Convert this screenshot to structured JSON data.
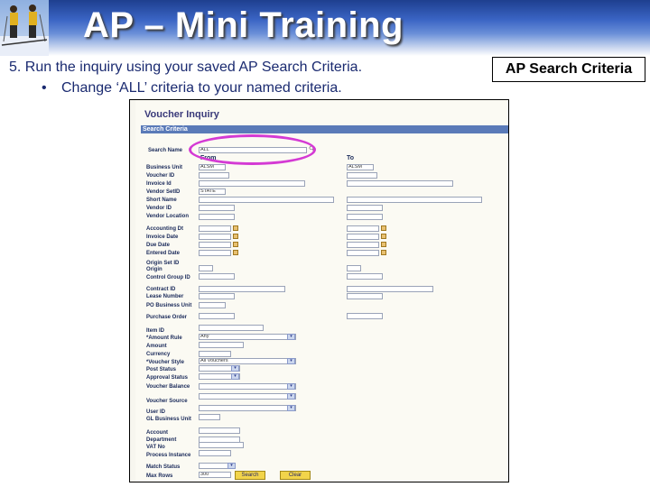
{
  "slide": {
    "title": "AP – Mini Training",
    "step_text": "5. Run the inquiry using your saved AP Search Criteria.",
    "bullet_text": "Change ‘ALL’ criteria to your named criteria.",
    "callout": "AP Search Criteria"
  },
  "inquiry": {
    "page_title": "Voucher Inquiry",
    "section_title": "Search Criteria",
    "search_name_label": "Search Name",
    "search_name_value": "ALL",
    "from_label": "From",
    "to_label": "To",
    "fields": {
      "business_unit": "Business Unit",
      "voucher_id": "Voucher ID",
      "invoice_id": "Invoice Id",
      "vendor_setid": "Vendor SetID",
      "short_name": "Short Name",
      "vendor_id": "Vendor ID",
      "vendor_location": "Vendor Location",
      "accounting_dt": "Accounting Dt",
      "invoice_date": "Invoice Date",
      "due_date": "Due Date",
      "entered_date": "Entered Date",
      "origin_set_id": "Origin Set ID",
      "origin": "Origin",
      "control_group_id": "Control Group ID",
      "contract_id": "Contract ID",
      "lease_number": "Lease Number",
      "po_business_unit": "PO Business Unit",
      "purchase_order": "Purchase Order",
      "item_id": "Item ID",
      "amount_rule": "*Amount Rule",
      "amount": "Amount",
      "currency": "Currency",
      "voucher_style": "*Voucher Style",
      "post_status": "Post Status",
      "approval_status": "Approval Status",
      "voucher_balance": "Voucher Balance",
      "voucher_source": "Voucher Source",
      "user_id": "User ID",
      "gl_business_unit": "GL Business Unit",
      "account": "Account",
      "department": "Department",
      "vat_no": "VAT No",
      "process_instance": "Process Instance",
      "match_status": "Match Status",
      "max_rows": "Max Rows"
    },
    "values": {
      "business_unit_from": "ALSM",
      "business_unit_to": "ALSM",
      "vendor_setid": "STATE",
      "amount_rule": "Any",
      "voucher_style": "All Vouchers",
      "max_rows": "300"
    },
    "buttons": {
      "search": "Search",
      "clear": "Clear"
    }
  }
}
